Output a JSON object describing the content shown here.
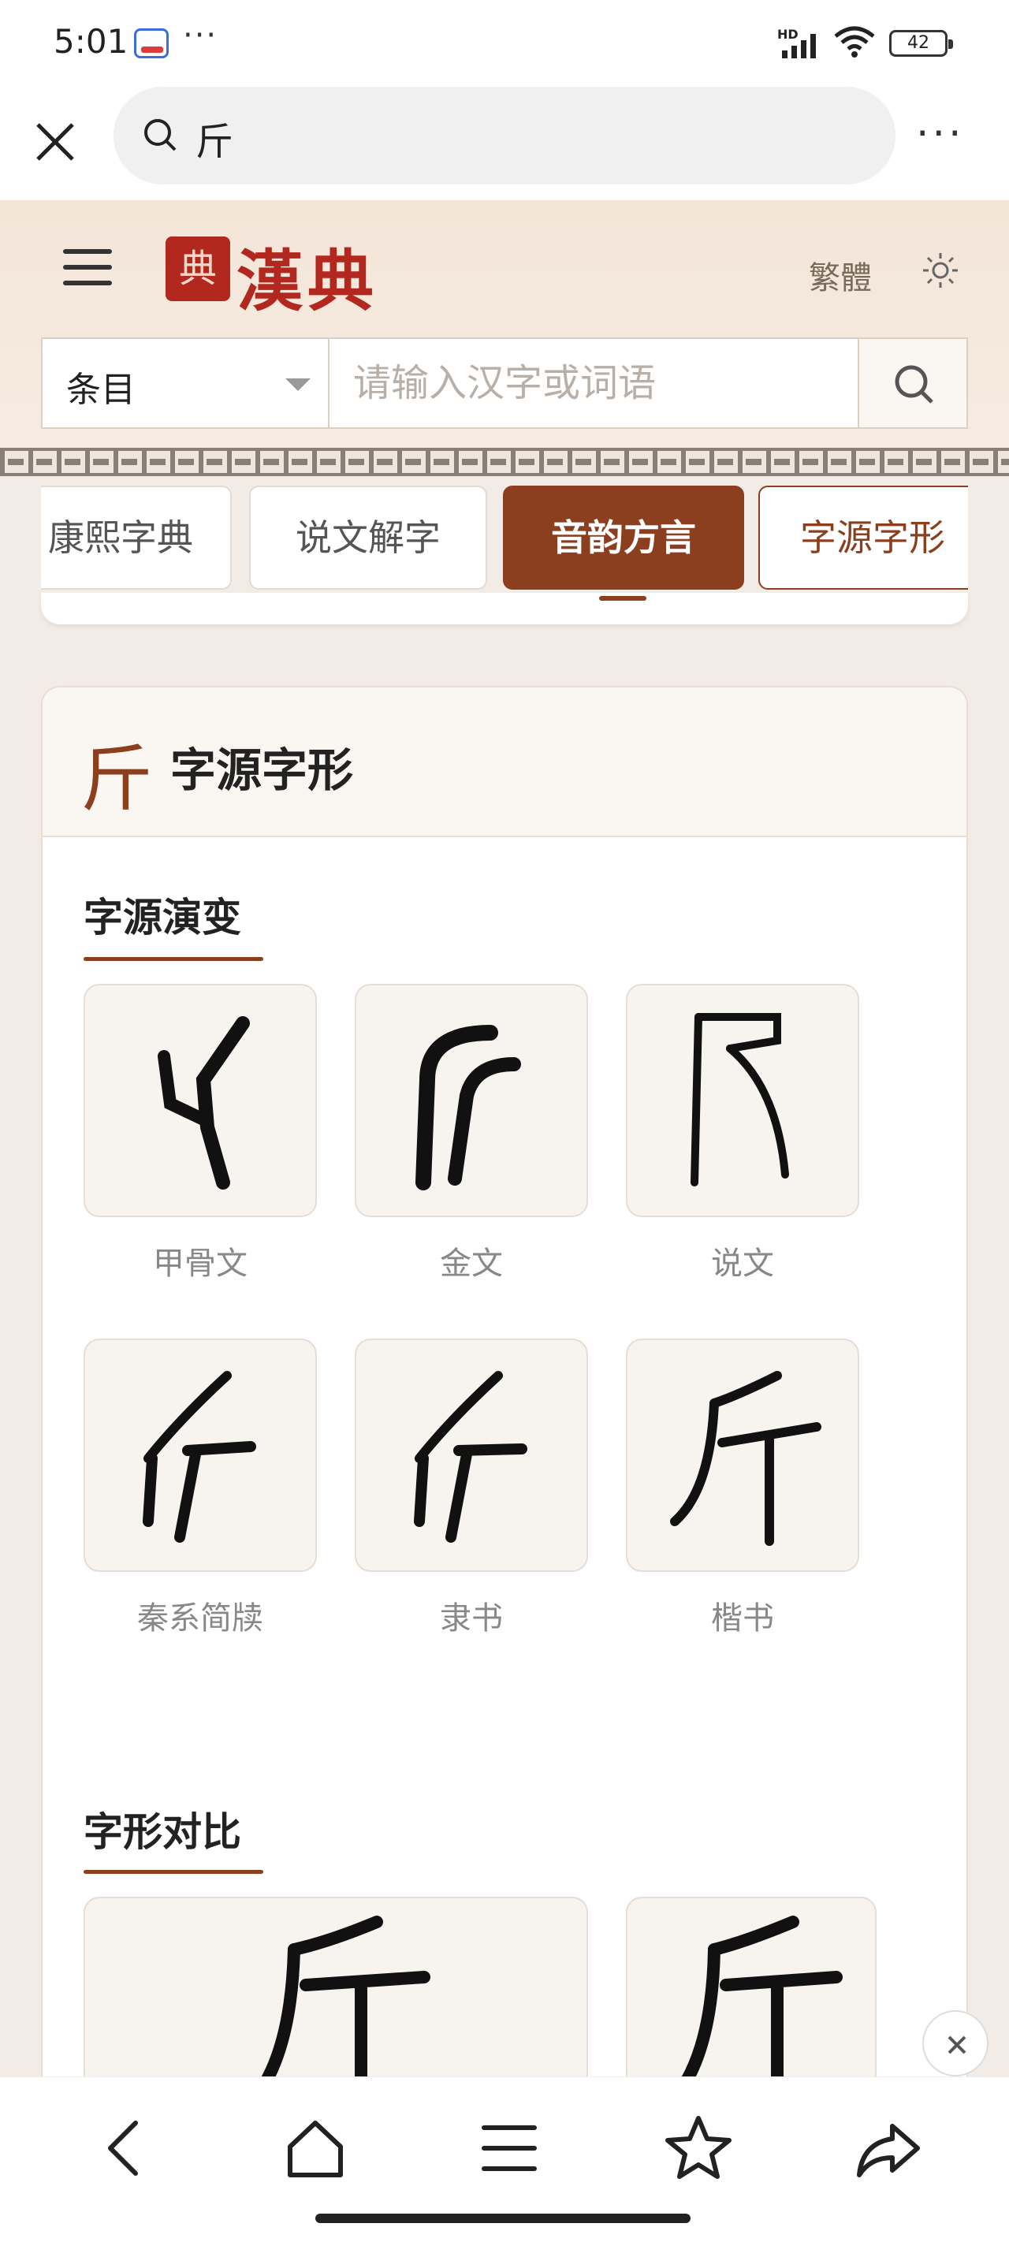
{
  "status_bar": {
    "time": "5:01",
    "more_indicator": "···",
    "network_label": "HD",
    "battery": "42"
  },
  "browser": {
    "query": "斤",
    "close_icon": "close-icon",
    "search_icon": "search-icon",
    "menu_icon": "more-dots-icon"
  },
  "site": {
    "logo_seal": "典",
    "logo_text": "漢典",
    "traditional_link": "繁體",
    "theme_icon": "sun-icon"
  },
  "search": {
    "category": "条目",
    "placeholder": "请输入汉字或词语"
  },
  "tabs": [
    {
      "label": "康熙字典",
      "state": "normal"
    },
    {
      "label": "说文解字",
      "state": "normal"
    },
    {
      "label": "音韵方言",
      "state": "active"
    },
    {
      "label": "字源字形",
      "state": "outlined"
    }
  ],
  "card": {
    "head_char": "斤",
    "head_title": "字源字形"
  },
  "evolution": {
    "title": "字源演变",
    "items": [
      {
        "label": "甲骨文"
      },
      {
        "label": "金文"
      },
      {
        "label": "说文"
      },
      {
        "label": "秦系简牍"
      },
      {
        "label": "隶书"
      },
      {
        "label": "楷书"
      }
    ]
  },
  "compare": {
    "title": "字形对比"
  },
  "bottom_nav": [
    "back-icon",
    "home-icon",
    "menu-icon",
    "star-icon",
    "share-icon"
  ],
  "colors": {
    "accent": "#8b3f1f",
    "brand_red": "#b2281f",
    "header_bg": "#f3e5d8",
    "page_bg": "#f3ece6"
  }
}
